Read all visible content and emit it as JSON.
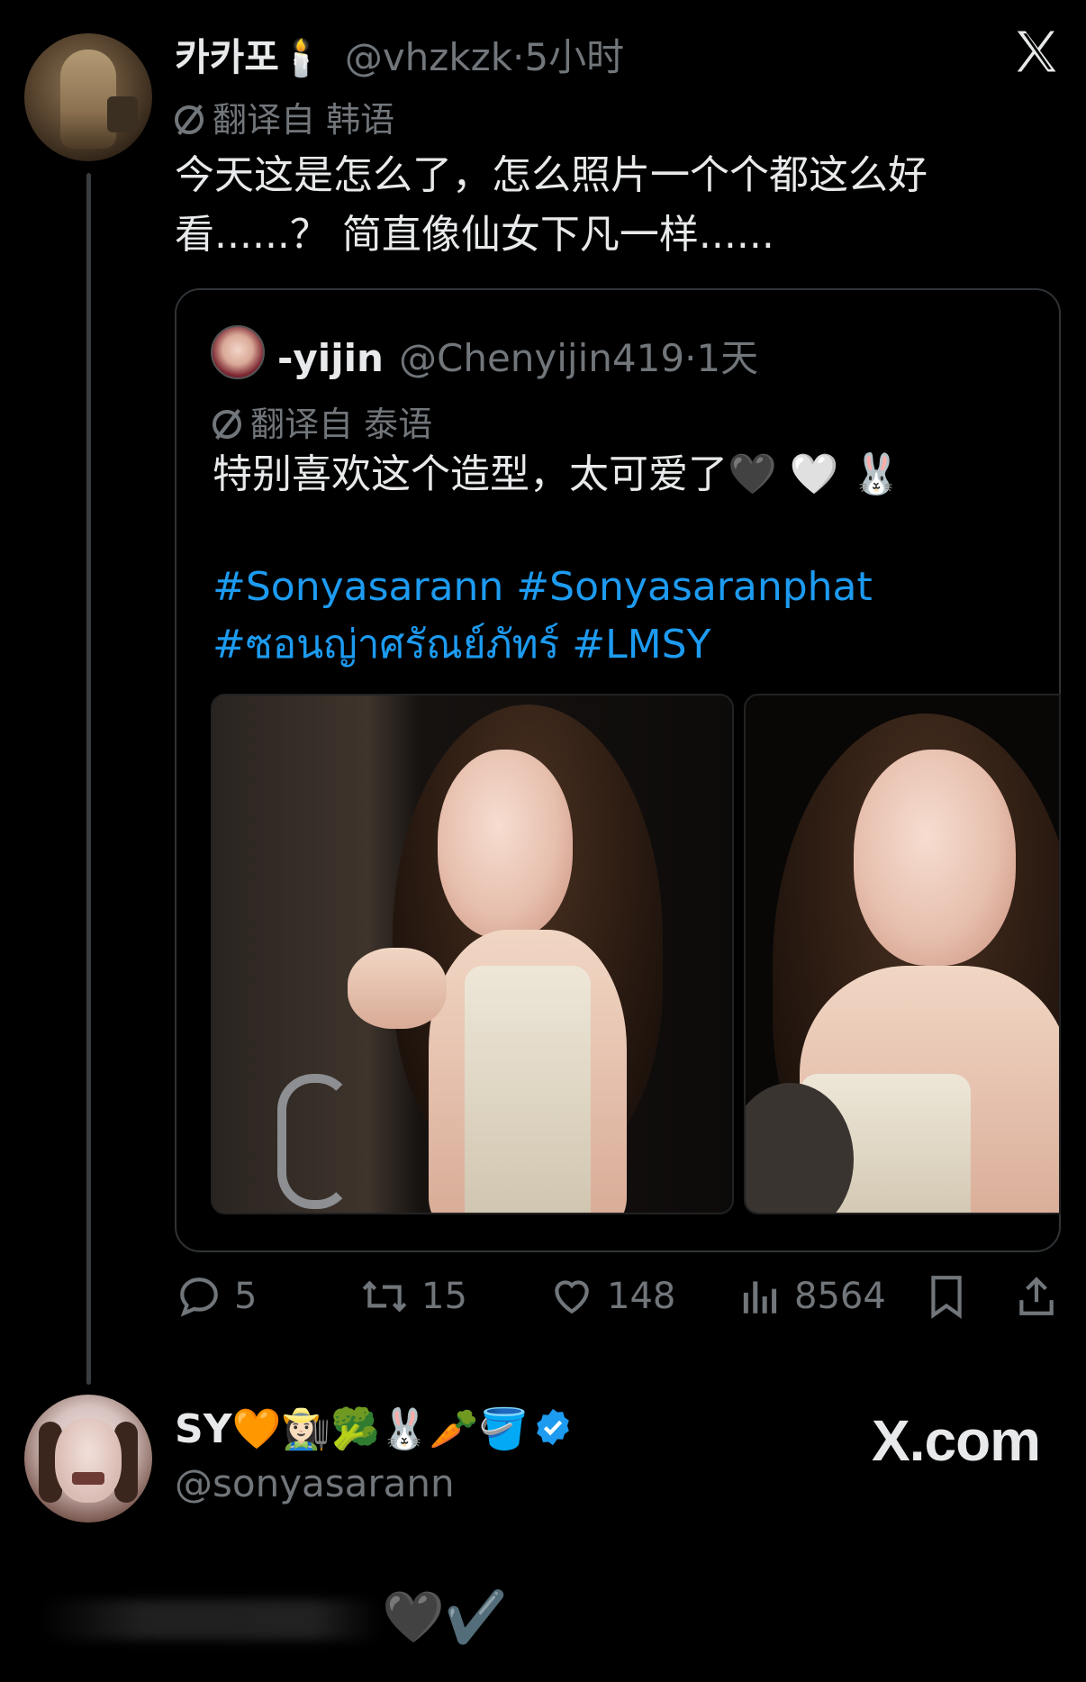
{
  "tweet": {
    "author_name": "카카포",
    "author_emoji": "🕯️",
    "handle": "@vhzkzk",
    "time": "5小时",
    "translated_label": "翻译自 韩语",
    "text_line1": "今天这是怎么了，怎么照片一个个都这么好",
    "text_line2": "看......？ 简直像仙女下凡一样......"
  },
  "quote": {
    "author_name": "-yijin",
    "handle": "@Chenyijin419",
    "time": "1天",
    "translated_label": "翻译自 泰语",
    "text": "特别喜欢这个造型，太可爱了🖤 🤍 🐰",
    "hashtag_line1": "#Sonyasarann #Sonyasaranphat",
    "hashtag_line2": "#ซอนญ่าศรัณย์ภัทร์ #LMSY"
  },
  "actions": {
    "replies": "5",
    "reposts": "15",
    "likes": "148",
    "views": "8564"
  },
  "reply": {
    "author_name": "SY🧡👩🏻‍🌾🥦🐰🥕🪣",
    "handle": "@sonyasarann",
    "verified": true,
    "partial_text_tail": "🖤✔️"
  },
  "watermark": "X.com",
  "colors": {
    "background": "#000000",
    "text": "#e7e9ea",
    "muted": "#71767b",
    "link": "#1d9bf0",
    "verified": "#1d9bf0",
    "border": "#2f3336"
  },
  "icons": [
    "translate-icon",
    "x-logo-icon",
    "reply-icon",
    "repost-icon",
    "like-icon",
    "views-icon",
    "bookmark-icon",
    "share-icon",
    "verified-badge-icon"
  ]
}
